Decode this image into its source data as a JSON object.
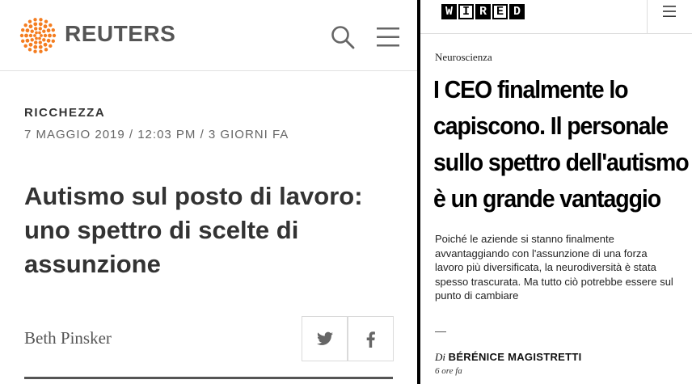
{
  "reuters": {
    "brand": "REUTERS",
    "section": "RICCHEZZA",
    "dateline": "7 MAGGIO 2019 / 12:03 PM / 3 GIORNI FA",
    "title": "Autismo sul posto di lavoro: uno spettro di scelte di assunzione",
    "author": "Beth Pinsker",
    "icons": [
      "reuters-logo-icon",
      "search-icon",
      "menu-icon",
      "twitter-icon",
      "facebook-icon"
    ],
    "colors": {
      "brand_orange": "#f47d20",
      "text": "#333333"
    }
  },
  "wired": {
    "logo_letters": [
      "W",
      "I",
      "R",
      "E",
      "D"
    ],
    "kicker": "Neuroscienza",
    "title_lines": [
      "I CEO finalmente lo",
      "capiscono. Il personale",
      "sullo spettro dell'autismo",
      "è un grande vantaggio"
    ],
    "summary": "Poiché le aziende si stanno finalmente avvantaggiando con l'assunzione di una forza lavoro più diversificata, la neurodiversità è stata spesso trascurata. Ma tutto ciò potrebbe essere sul punto di cambiare",
    "byline_prefix": "Di",
    "byline_name": "BÉRÉNICE MAGISTRETTI",
    "time": "6 ore fa",
    "icons": [
      "wired-logo",
      "menu-icon"
    ]
  }
}
